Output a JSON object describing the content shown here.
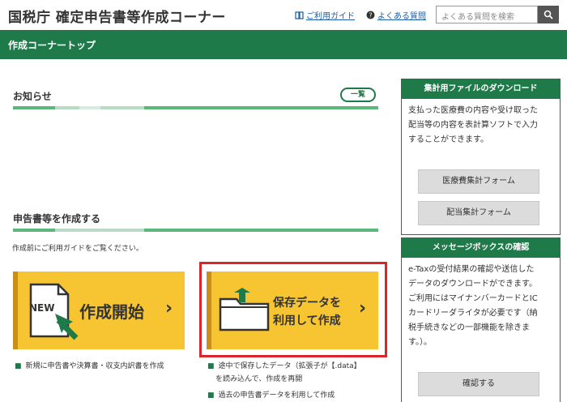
{
  "header": {
    "title": "国税庁 確定申告書等作成コーナー",
    "guide_link": "ご利用ガイド",
    "faq_link": "よくある質問",
    "search_placeholder": "よくある質問を検索"
  },
  "navbar": {
    "title": "作成コーナートップ"
  },
  "notice": {
    "title": "お知らせ",
    "more_button": "一覧"
  },
  "create": {
    "title": "申告書等を作成する",
    "note": "作成前にご利用ガイドをご覧ください。",
    "new_tile": {
      "badge": "NEW",
      "label": "作成開始"
    },
    "saved_tile": {
      "line1": "保存データを",
      "line2": "利用して作成"
    },
    "new_bullets": [
      "新規に申告書や決算書・収支内訳書を作成"
    ],
    "saved_bullets": [
      "途中で保存したデータ（拡張子が【.data】",
      "を読み込んで、作成を再開",
      "過去の申告書データを利用して作成"
    ]
  },
  "sidebar": {
    "download": {
      "title": "集計用ファイルのダウンロード",
      "lines": [
        "支払った医療費の内容や受け取った",
        "配当等の内容を表計算ソフトで入力",
        "することができます。"
      ],
      "buttons": [
        "医療費集計フォーム",
        "配当集計フォーム"
      ]
    },
    "messagebox": {
      "title": "メッセージボックスの確認",
      "lines": [
        "e-Taxの受付結果の確認や送信した",
        "データのダウンロードができます。",
        "ご利用にはマイナンバーカードとIC",
        "カードリーダライタが必要です（納",
        "税手続きなどの一部機能を除きま",
        "す。）。"
      ],
      "button": "確認する"
    }
  },
  "colors": {
    "brand_green": "#1f7a4a",
    "tile_yellow": "#f7c531",
    "highlight_red": "#d9262b"
  }
}
